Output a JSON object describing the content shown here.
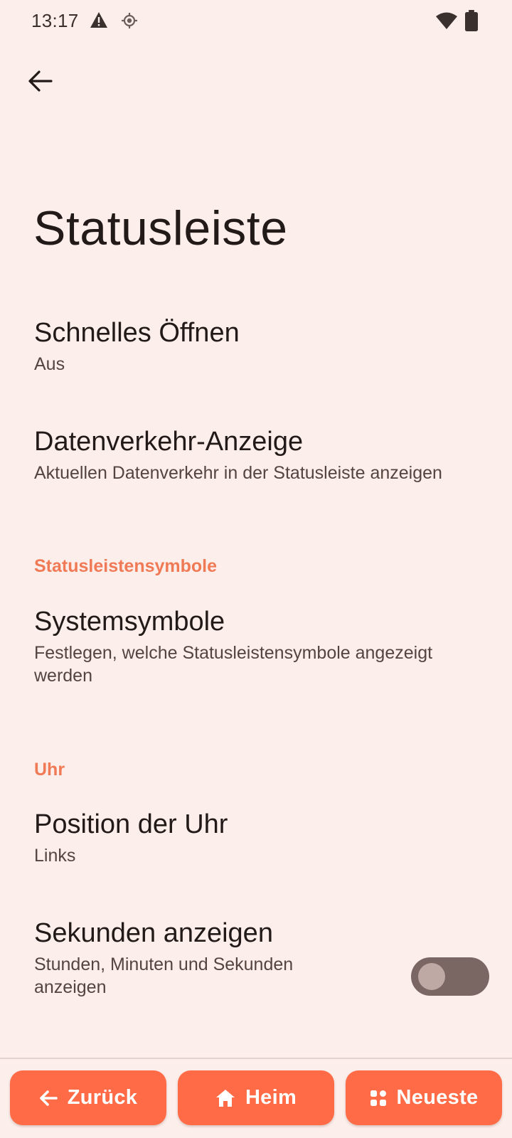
{
  "status_bar": {
    "time": "13:17",
    "icons": [
      "warning-icon",
      "location-icon",
      "wifi-icon",
      "battery-icon"
    ]
  },
  "header": {
    "back_icon": "arrow-left-icon",
    "title": "Statusleiste"
  },
  "settings": {
    "quick_open": {
      "title": "Schnelles Öffnen",
      "summary": "Aus"
    },
    "data_traffic": {
      "title": "Datenverkehr-Anzeige",
      "summary": "Aktuellen Datenverkehr in der Statusleiste anzeigen"
    },
    "category_icons": "Statusleistensymbole",
    "system_icons": {
      "title": "Systemsymbole",
      "summary": "Festlegen, welche Statusleistensymbole angezeigt werden"
    },
    "category_clock": "Uhr",
    "clock_position": {
      "title": "Position der Uhr",
      "summary": "Links"
    },
    "show_seconds": {
      "title": "Sekunden anzeigen",
      "summary": "Stunden, Minuten und Sekunden anzeigen",
      "enabled": false
    }
  },
  "nav": {
    "back_label": "Zurück",
    "home_label": "Heim",
    "recent_label": "Neueste"
  },
  "colors": {
    "background": "#FCEEEB",
    "accent": "#F07A55",
    "nav_button": "#FF6B47",
    "toggle_track_off": "#7A6663",
    "toggle_thumb_off": "#BFA9A5"
  }
}
